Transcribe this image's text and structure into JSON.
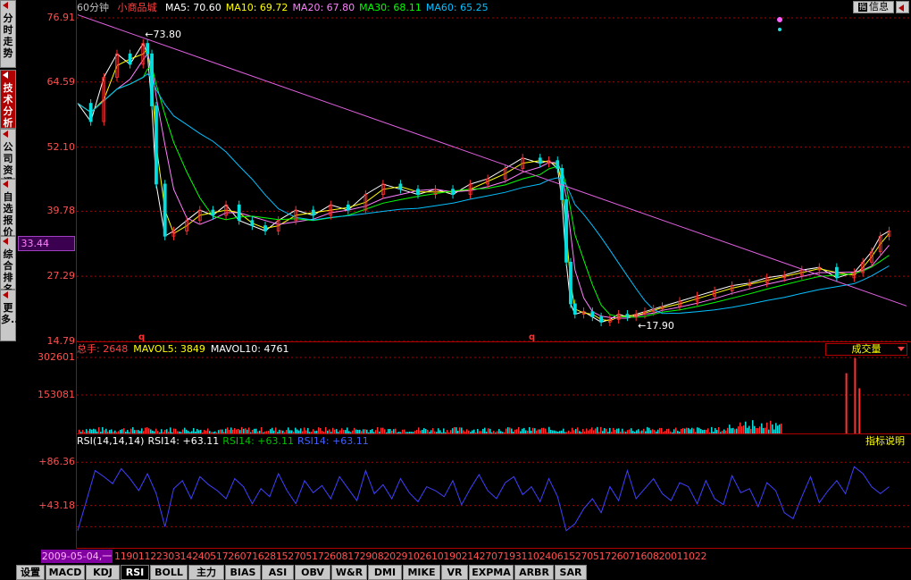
{
  "window": {
    "period": "60分钟",
    "stock_name": "小商品城"
  },
  "info_button": {
    "icon_label": "指",
    "label": "信息"
  },
  "left_tabs": [
    {
      "label": "分时走势",
      "active": false
    },
    {
      "label": "技术分析",
      "active": true
    },
    {
      "label": "公司资讯",
      "active": false
    },
    {
      "label": "自选报价",
      "active": false
    },
    {
      "label": "综合排名",
      "active": false
    },
    {
      "label": "更多...",
      "active": false
    }
  ],
  "price_legend": [
    {
      "text": "MA5: 70.60",
      "color": "#ffffff"
    },
    {
      "text": "MA10: 69.72",
      "color": "#ffff00"
    },
    {
      "text": "MA20: 67.80",
      "color": "#ff80ff"
    },
    {
      "text": "MA30: 68.11",
      "color": "#00ff00"
    },
    {
      "text": "MA60: 65.25",
      "color": "#00c0ff"
    }
  ],
  "volume_legend": [
    {
      "text": "总手: 2648",
      "color": "#ff4040"
    },
    {
      "text": "MAVOL5: 3849",
      "color": "#ffff00"
    },
    {
      "text": "MAVOL10: 4761",
      "color": "#ffffff"
    }
  ],
  "volume_selector": "成交量",
  "rsi_legend": [
    {
      "text": "RSI(14,14,14)",
      "color": "#ffffff"
    },
    {
      "text": "RSI14: +63.11",
      "color": "#ffffff"
    },
    {
      "text": "RSI14: +63.11",
      "color": "#00c000"
    },
    {
      "text": "RSI14: +63.11",
      "color": "#4060ff"
    }
  ],
  "indicator_help": "指标说明",
  "current_price": "33.44",
  "date_box": "2009-05-04,一",
  "x_ticks": "119011223031424051726071628152705172608172908202910261019021427071931102406152705172607160820011022",
  "bottom_tabs": [
    {
      "label": "设置",
      "active": false
    },
    {
      "label": "MACD",
      "active": false
    },
    {
      "label": "KDJ",
      "active": false
    },
    {
      "label": "RSI",
      "active": true
    },
    {
      "label": "BOLL",
      "active": false
    },
    {
      "label": "主力",
      "active": false
    },
    {
      "label": "BIAS",
      "active": false
    },
    {
      "label": "ASI",
      "active": false
    },
    {
      "label": "OBV",
      "active": false
    },
    {
      "label": "W&R",
      "active": false
    },
    {
      "label": "DMI",
      "active": false
    },
    {
      "label": "MIKE",
      "active": false
    },
    {
      "label": "VR",
      "active": false
    },
    {
      "label": "EXPMA",
      "active": false
    },
    {
      "label": "ARBR",
      "active": false
    },
    {
      "label": "SAR",
      "active": false
    }
  ],
  "chart_data": [
    {
      "type": "line",
      "panel": "price",
      "y_ticks": [
        "76.91",
        "64.59",
        "52.10",
        "39.78",
        "27.29",
        "14.79"
      ],
      "ylim": [
        14.79,
        76.91
      ],
      "annotations": [
        {
          "text": "73.80",
          "x": 15,
          "y": 73.8
        },
        {
          "text": "17.90",
          "x": 128,
          "y": 17.9
        }
      ],
      "trendline": {
        "x": [
          0,
          190
        ],
        "y": [
          77.5,
          21.6
        ]
      },
      "series": [
        {
          "name": "MA5",
          "color": "#ffffff"
        },
        {
          "name": "MA10",
          "color": "#ffff00"
        },
        {
          "name": "MA20",
          "color": "#ff80ff"
        },
        {
          "name": "MA30",
          "color": "#00ff00"
        },
        {
          "name": "MA60",
          "color": "#00c0ff"
        }
      ],
      "x": [
        0,
        3,
        6,
        9,
        12,
        15,
        16,
        17,
        18,
        20,
        22,
        25,
        28,
        31,
        34,
        37,
        40,
        43,
        46,
        50,
        54,
        58,
        62,
        66,
        70,
        74,
        78,
        82,
        86,
        90,
        94,
        98,
        102,
        106,
        108,
        110,
        111,
        112,
        113,
        114,
        116,
        118,
        120,
        122,
        124,
        126,
        128,
        130,
        132,
        134,
        138,
        142,
        146,
        150,
        154,
        158,
        162,
        166,
        170,
        174,
        178,
        180,
        182,
        184,
        186
      ],
      "close": [
        60.5,
        57.0,
        65.5,
        70.0,
        68.0,
        72.0,
        70.0,
        60.0,
        45.0,
        35.0,
        36.0,
        38.0,
        40.0,
        39.0,
        41.0,
        38.0,
        37.0,
        36.0,
        38.0,
        40.0,
        39.0,
        41.0,
        40.0,
        43.0,
        45.0,
        44.0,
        43.0,
        44.0,
        43.0,
        45.0,
        46.0,
        48.0,
        50.0,
        49.0,
        49.5,
        48.0,
        42.0,
        30.0,
        22.0,
        20.0,
        20.5,
        19.5,
        18.5,
        19.0,
        20.0,
        19.5,
        20.0,
        20.5,
        21.0,
        21.5,
        22.5,
        23.5,
        24.5,
        25.5,
        26.0,
        27.0,
        27.5,
        28.5,
        29.0,
        27.0,
        28.0,
        30.0,
        32.0,
        35.0,
        36.0
      ]
    },
    {
      "type": "bar",
      "panel": "volume",
      "y_ticks": [
        "302601",
        "153081"
      ],
      "ylim": [
        0,
        302601
      ],
      "spikes": [
        {
          "x": 176,
          "value": 240000
        },
        {
          "x": 178,
          "value": 300000
        },
        {
          "x": 179,
          "value": 180000
        }
      ]
    },
    {
      "type": "line",
      "panel": "rsi",
      "y_ticks": [
        "+86.36",
        "+43.18"
      ],
      "ylim": [
        0,
        100
      ],
      "series": [
        {
          "name": "RSI14",
          "color": "#4040ff"
        }
      ],
      "x": [
        0,
        2,
        4,
        6,
        8,
        10,
        12,
        14,
        16,
        18,
        20,
        22,
        24,
        26,
        28,
        30,
        32,
        34,
        36,
        38,
        40,
        42,
        44,
        46,
        48,
        50,
        52,
        54,
        56,
        58,
        60,
        62,
        64,
        66,
        68,
        70,
        72,
        74,
        76,
        78,
        80,
        82,
        84,
        86,
        88,
        90,
        92,
        94,
        96,
        98,
        100,
        102,
        104,
        106,
        108,
        110,
        112,
        114,
        116,
        118,
        120,
        122,
        124,
        126,
        128,
        130,
        132,
        134,
        136,
        138,
        140,
        142,
        144,
        146,
        148,
        150,
        152,
        154,
        156,
        158,
        160,
        162,
        164,
        166,
        168,
        170,
        172,
        174,
        176,
        178,
        180,
        182,
        184,
        186
      ],
      "values": [
        18,
        48,
        78,
        72,
        65,
        80,
        70,
        58,
        75,
        55,
        22,
        60,
        68,
        50,
        72,
        64,
        58,
        50,
        70,
        62,
        45,
        60,
        52,
        75,
        58,
        45,
        68,
        56,
        63,
        50,
        72,
        60,
        48,
        78,
        55,
        64,
        50,
        70,
        56,
        47,
        62,
        58,
        52,
        68,
        44,
        60,
        74,
        58,
        50,
        66,
        72,
        54,
        62,
        47,
        70,
        52,
        18,
        25,
        40,
        50,
        36,
        62,
        48,
        78,
        50,
        60,
        70,
        55,
        48,
        66,
        62,
        45,
        68,
        50,
        44,
        73,
        56,
        60,
        42,
        66,
        58,
        36,
        30,
        52,
        72,
        46,
        58,
        68,
        55,
        82,
        75,
        62,
        55,
        62
      ]
    }
  ]
}
